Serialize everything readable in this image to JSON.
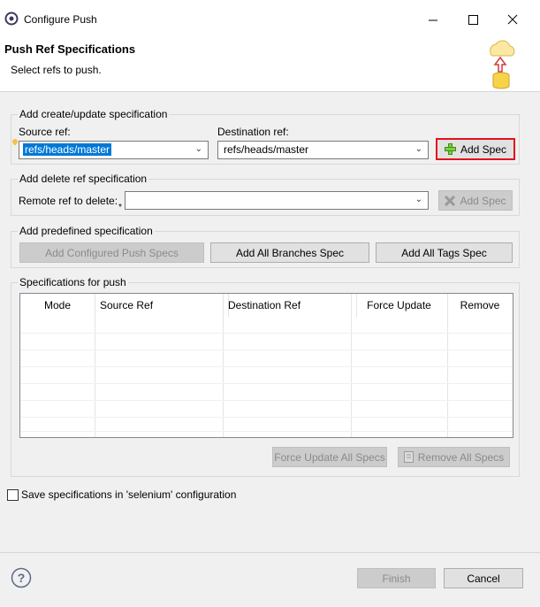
{
  "window": {
    "title": "Configure Push"
  },
  "header": {
    "title": "Push Ref Specifications",
    "subtitle": "Select refs to push."
  },
  "create_update": {
    "group_label": "Add create/update specification",
    "source_label": "Source ref:",
    "source_value": "refs/heads/master",
    "dest_label": "Destination ref:",
    "dest_value": "refs/heads/master",
    "add_spec": "Add Spec"
  },
  "delete_spec": {
    "group_label": "Add delete ref specification",
    "remote_label": "Remote ref to delete:",
    "remote_value": "",
    "add_spec": "Add Spec"
  },
  "predefined": {
    "group_label": "Add predefined specification",
    "configured": "Add Configured Push Specs",
    "all_branches": "Add All Branches Spec",
    "all_tags": "Add All Tags Spec"
  },
  "specs": {
    "group_label": "Specifications for push",
    "columns": [
      "Mode",
      "Source Ref",
      "Destination Ref",
      "Force Update",
      "Remove"
    ],
    "force_all": "Force Update All Specs",
    "remove_all": "Remove All Specs"
  },
  "save_option": {
    "label": "Save specifications in 'selenium' configuration",
    "checked": false
  },
  "footer": {
    "finish": "Finish",
    "cancel": "Cancel"
  }
}
